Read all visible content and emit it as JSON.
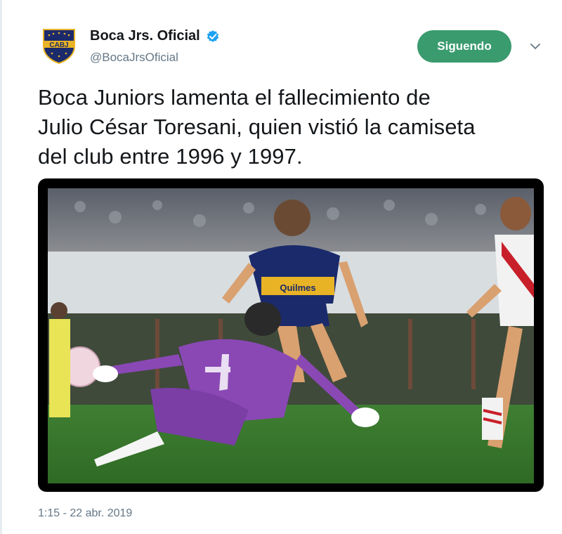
{
  "account": {
    "display_name": "Boca Jrs. Oficial",
    "handle": "@BocaJrsOficial",
    "avatar_text": "CABJ",
    "verified": true
  },
  "actions": {
    "follow_label": "Siguendo"
  },
  "tweet": {
    "line1": "Boca Juniors lamenta el fallecimiento de",
    "line2": "Julio César Toresani, quien vistió la camiseta",
    "line3": "del club entre 1996 y 1997.",
    "timestamp": "1:15 - 22 abr. 2019"
  },
  "media": {
    "jersey_sponsor_text": "Quilmes",
    "colors": {
      "brand_green": "#3a9b6f",
      "boca_blue": "#1b2a6b",
      "boca_gold": "#e8b325",
      "keeper_purple": "#8a48b5",
      "pitch": "#3c7a2e"
    }
  },
  "icons": {
    "verified": "verified-badge-icon",
    "caret": "chevron-down-icon"
  }
}
